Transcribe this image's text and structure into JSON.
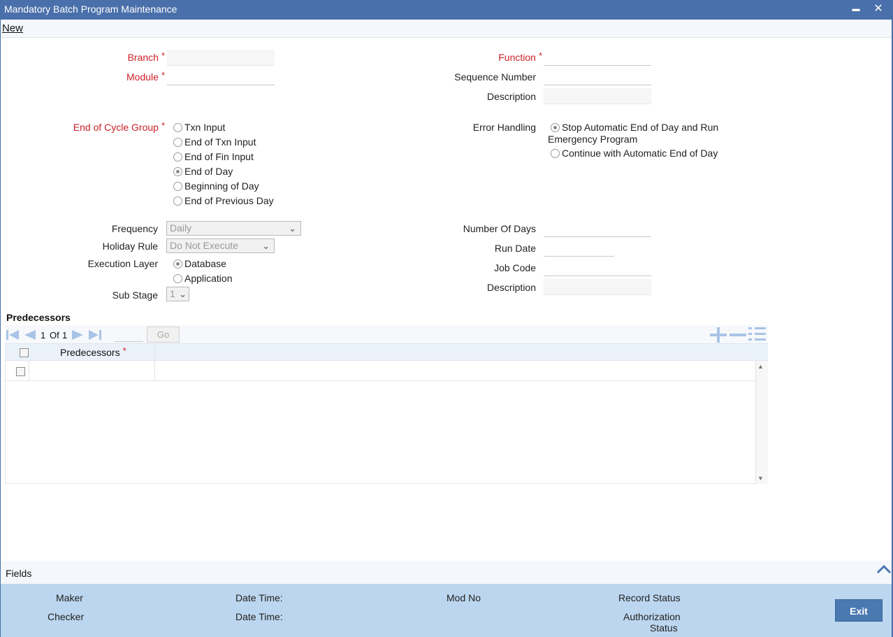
{
  "window": {
    "title": "Mandatory Batch Program Maintenance",
    "minimize_glyph": "▬",
    "close_glyph": "✕"
  },
  "toolbar": {
    "new_label": "New"
  },
  "form": {
    "branch_label": "Branch",
    "module_label": "Module",
    "function_label": "Function",
    "sequence_number_label": "Sequence Number",
    "description_label": "Description",
    "required_mark": "*",
    "end_of_cycle": {
      "label": "End of Cycle Group",
      "options": [
        "Txn Input",
        "End of Txn Input",
        "End of Fin Input",
        "End of Day",
        "Beginning of Day",
        "End of Previous Day"
      ],
      "selected": "End of Day"
    },
    "error_handling": {
      "label": "Error Handling",
      "option1_line1": "Stop Automatic End of Day and Run",
      "option1_line2": "Emergency Program",
      "option2": "Continue with Automatic End of Day",
      "selected": "option1"
    },
    "frequency": {
      "label": "Frequency",
      "value": "Daily"
    },
    "holiday_rule": {
      "label": "Holiday Rule",
      "value": "Do Not Execute"
    },
    "execution_layer": {
      "label": "Execution Layer",
      "options": [
        "Database",
        "Application"
      ],
      "selected": "Database"
    },
    "sub_stage": {
      "label": "Sub Stage",
      "value": "1"
    },
    "number_of_days_label": "Number Of Days",
    "run_date_label": "Run Date",
    "job_code_label": "Job Code",
    "description2_label": "Description"
  },
  "predecessors": {
    "section_title": "Predecessors",
    "page_current": "1",
    "page_of": "Of",
    "page_total": "1",
    "go_label": "Go",
    "column_header": "Predecessors"
  },
  "footer": {
    "fields_label": "Fields",
    "maker_label": "Maker",
    "checker_label": "Checker",
    "date_time_label": "Date Time:",
    "mod_no_label": "Mod No",
    "record_status_label": "Record Status",
    "auth_status_line1": "Authorization",
    "auth_status_line2": "Status",
    "exit_label": "Exit"
  },
  "colors": {
    "titlebar": "#4a70ab",
    "required": "#cc1f26",
    "footer": "#bcd6ef",
    "button": "#4a78b0",
    "nav_icon": "#a9c4e6"
  }
}
